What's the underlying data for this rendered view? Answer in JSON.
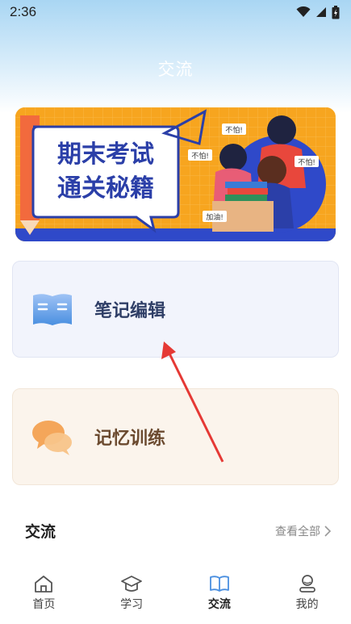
{
  "status_bar": {
    "time": "2:36"
  },
  "header": {
    "title": "交流"
  },
  "banner": {
    "headline_line1": "期末考试",
    "headline_line2": "通关秘籍",
    "bubble1": "不怕!",
    "bubble2": "不怕!",
    "bubble3": "不怕!",
    "bubble4": "加油!"
  },
  "cards": [
    {
      "label": "笔记编辑",
      "icon": "book-icon"
    },
    {
      "label": "记忆训练",
      "icon": "chat-bubbles-icon"
    }
  ],
  "section": {
    "title": "交流",
    "view_all": "查看全部"
  },
  "tabbar": {
    "items": [
      {
        "label": "首页",
        "icon": "home-icon"
      },
      {
        "label": "学习",
        "icon": "graduation-cap-icon"
      },
      {
        "label": "交流",
        "icon": "open-book-icon",
        "active": true
      },
      {
        "label": "我的",
        "icon": "user-icon"
      }
    ]
  },
  "colors": {
    "accent": "#4a8fe0",
    "banner_bg": "#f7a51f",
    "banner_text": "#2b3fa8",
    "arrow": "#e53935"
  }
}
